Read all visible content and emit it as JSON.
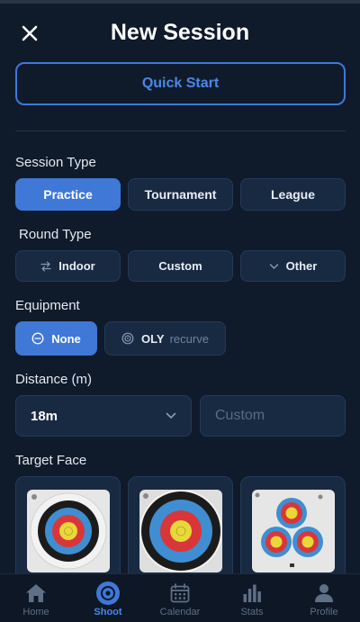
{
  "header": {
    "title": "New Session",
    "close_icon": "close-icon"
  },
  "quick_start": {
    "label": "Quick Start"
  },
  "session_type": {
    "label": "Session Type",
    "options": [
      "Practice",
      "Tournament",
      "League"
    ],
    "selected": "Practice"
  },
  "round_type": {
    "label": "Round Type",
    "options": [
      {
        "label": "Indoor",
        "icon": "swap-arrows-icon"
      },
      {
        "label": "Custom",
        "icon": ""
      },
      {
        "label": "Other",
        "icon": "chevron-down-icon"
      }
    ]
  },
  "equipment": {
    "label": "Equipment",
    "options": [
      {
        "label": "None",
        "icon": "minus-circle-icon",
        "selected": true
      },
      {
        "label": "OLY",
        "sub": "recurve",
        "icon": "target-circle-icon",
        "selected": false
      }
    ]
  },
  "distance": {
    "label": "Distance (m)",
    "selected": "18m",
    "custom_placeholder": "Custom"
  },
  "target_face": {
    "label": "Target Face",
    "faces": [
      "40cm-full-face",
      "large-full-face",
      "triple-spot"
    ]
  },
  "bottom_nav": {
    "items": [
      {
        "label": "Home",
        "icon": "home-icon"
      },
      {
        "label": "Shoot",
        "icon": "shoot-target-icon",
        "active": true
      },
      {
        "label": "Calendar",
        "icon": "calendar-icon"
      },
      {
        "label": "Stats",
        "icon": "stats-bars-icon"
      },
      {
        "label": "Profile",
        "icon": "profile-icon"
      }
    ]
  },
  "colors": {
    "background": "#0f1a2b",
    "accent": "#3f78d6",
    "chip": "#182a42",
    "target_yellow": "#e9d83a",
    "target_red": "#d9363a",
    "target_blue": "#3f8ed1",
    "target_black": "#1a1a1a"
  }
}
